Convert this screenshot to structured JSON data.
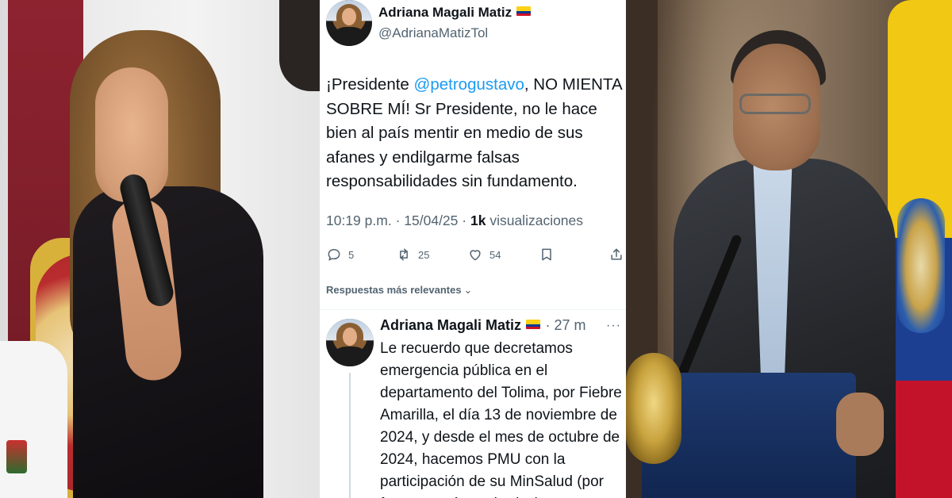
{
  "tweet": {
    "author": {
      "display_name": "Adriana Magali Matiz",
      "handle": "@AdrianaMatizTol",
      "flag_icon": "colombia-flag-icon"
    },
    "text_prefix": "¡Presidente ",
    "mention": "@petrogustavo",
    "text_suffix": ", NO MIENTA SOBRE MÍ! Sr Presidente, no le hace bien al país mentir en medio de sus afanes y endilgarme falsas responsabilidades sin fundamento.",
    "time": "10:19 p.m.",
    "separator": "·",
    "date": "15/04/25",
    "views_count": "1k",
    "views_label": "visualizaciones",
    "actions": {
      "replies": "5",
      "retweets": "25",
      "likes": "54"
    }
  },
  "replies_sort": {
    "label": "Respuestas más relevantes",
    "chevron": "⌄"
  },
  "reply": {
    "display_name": "Adriana Magali Matiz",
    "time": "· 27 m",
    "more": "···",
    "text": "Le recuerdo que decretamos emergencia pública en el departamento del Tolima, por Fiebre Amarilla, el día 13 de noviembre de 2024, y desde el mes de octubre de 2024, hacemos PMU con la participación de su MinSalud (por fortuna están grabados)"
  },
  "colors": {
    "link": "#1d9bf0",
    "text_primary": "#0f1419",
    "text_secondary": "#536471",
    "divider": "#eff3f4"
  }
}
